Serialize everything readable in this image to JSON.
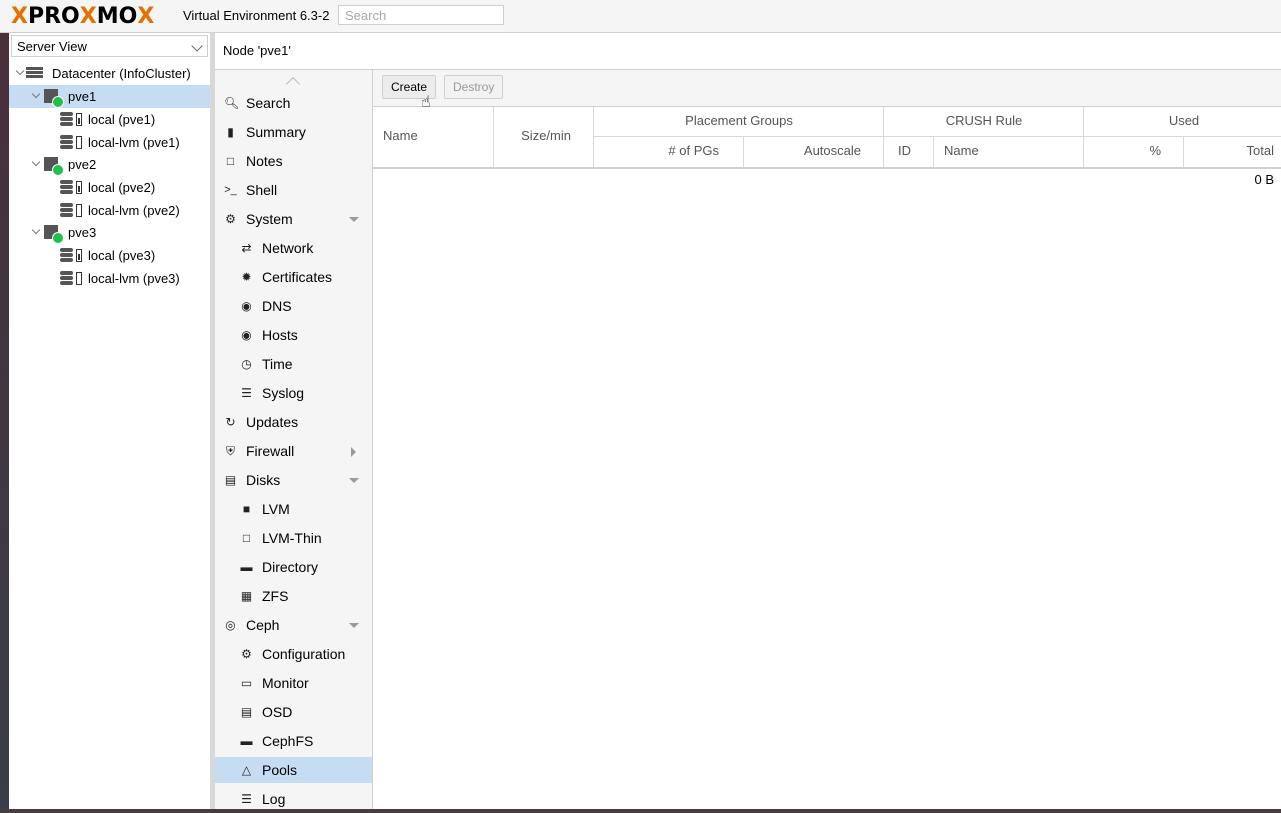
{
  "header": {
    "logo": {
      "x1": "X",
      "p": "PRO",
      "x2": "X",
      "m": "MO",
      "x3": "X"
    },
    "version": "Virtual Environment 6.3-2",
    "search_placeholder": "Search"
  },
  "tree": {
    "view": "Server View",
    "datacenter": "Datacenter (InfoCluster)",
    "nodes": [
      {
        "name": "pve1",
        "storages": [
          "local (pve1)",
          "local-lvm (pve1)"
        ]
      },
      {
        "name": "pve2",
        "storages": [
          "local (pve2)",
          "local-lvm (pve2)"
        ]
      },
      {
        "name": "pve3",
        "storages": [
          "local (pve3)",
          "local-lvm (pve3)"
        ]
      }
    ]
  },
  "content": {
    "title": "Node 'pve1'"
  },
  "menu": {
    "items": [
      {
        "label": "Search",
        "icon": "search-icon"
      },
      {
        "label": "Summary",
        "icon": "book-icon"
      },
      {
        "label": "Notes",
        "icon": "note-icon"
      },
      {
        "label": "Shell",
        "icon": "terminal-icon"
      },
      {
        "label": "System",
        "icon": "cogs-icon"
      },
      {
        "label": "Network",
        "icon": "exchange-icon"
      },
      {
        "label": "Certificates",
        "icon": "certificate-icon"
      },
      {
        "label": "DNS",
        "icon": "globe-icon"
      },
      {
        "label": "Hosts",
        "icon": "globe-icon"
      },
      {
        "label": "Time",
        "icon": "clock-icon"
      },
      {
        "label": "Syslog",
        "icon": "list-icon"
      },
      {
        "label": "Updates",
        "icon": "refresh-icon"
      },
      {
        "label": "Firewall",
        "icon": "shield-icon"
      },
      {
        "label": "Disks",
        "icon": "hdd-icon"
      },
      {
        "label": "LVM",
        "icon": "square-icon"
      },
      {
        "label": "LVM-Thin",
        "icon": "square-outline-icon"
      },
      {
        "label": "Directory",
        "icon": "folder-icon"
      },
      {
        "label": "ZFS",
        "icon": "th-large-icon"
      },
      {
        "label": "Ceph",
        "icon": "ceph-icon"
      },
      {
        "label": "Configuration",
        "icon": "gear-icon"
      },
      {
        "label": "Monitor",
        "icon": "desktop-icon"
      },
      {
        "label": "OSD",
        "icon": "hdd-icon"
      },
      {
        "label": "CephFS",
        "icon": "folder-icon"
      },
      {
        "label": "Pools",
        "icon": "sitemap-icon"
      },
      {
        "label": "Log",
        "icon": "list-icon"
      }
    ]
  },
  "toolbar": {
    "create": "Create",
    "destroy": "Destroy"
  },
  "grid": {
    "name": "Name",
    "size": "Size/min",
    "pg_group": "Placement Groups",
    "pg_num": "# of PGs",
    "autoscale": "Autoscale",
    "crush_group": "CRUSH Rule",
    "crush_id": "ID",
    "crush_name": "Name",
    "used_group": "Used",
    "used_pct": "%",
    "used_total": "Total",
    "total_value": "0 B"
  }
}
